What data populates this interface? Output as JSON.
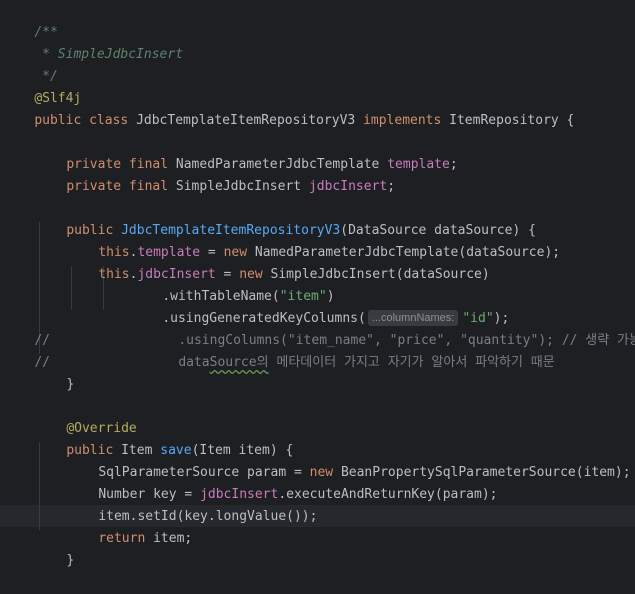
{
  "code": {
    "doc_open": "/**",
    "doc_title": " * SimpleJdbcInsert",
    "doc_close": " */",
    "annotation_slf4j": "@Slf4j",
    "class_decl": {
      "kw1": "public ",
      "kw2": "class ",
      "name": "JdbcTemplateItemRepositoryV3 ",
      "kw3": "implements ",
      "iface": "ItemRepository {"
    },
    "field1": {
      "kw": "private final ",
      "type": "NamedParameterJdbcTemplate ",
      "name": "template",
      "end": ";"
    },
    "field2": {
      "kw": "private final ",
      "type": "SimpleJdbcInsert ",
      "name": "jdbcInsert",
      "end": ";"
    },
    "ctor": {
      "kw": "public ",
      "name": "JdbcTemplateItemRepositoryV3",
      "params": "(DataSource dataSource) {"
    },
    "assign1": {
      "this": "this",
      "dot": ".",
      "field": "template",
      "eq": " = ",
      "new": "new ",
      "rest": "NamedParameterJdbcTemplate(dataSource);"
    },
    "assign2": {
      "this": "this",
      "dot": ".",
      "field": "jdbcInsert",
      "eq": " = ",
      "new": "new ",
      "rest": "SimpleJdbcInsert(dataSource)"
    },
    "with_table": {
      "pre": ".withTableName(",
      "str": "\"item\"",
      "post": ")"
    },
    "using_key": {
      "pre": ".usingGeneratedKeyColumns(",
      "hint": "...columnNames:",
      "str": "\"id\"",
      "post": ");"
    },
    "comment_line1": {
      "slashes": "//",
      "text": ".usingColumns(\"item_name\", \"price\", \"quantity\"); // 생략 가능."
    },
    "comment_line2": {
      "slashes": "//",
      "pre": "data",
      "underlined": "Source의",
      "post": " 메타데이터 가지고 자기가 알아서 파악하기 때문"
    },
    "ctor_close": "}",
    "override": "@Override",
    "save_decl": {
      "kw": "public ",
      "type": "Item ",
      "name": "save",
      "params": "(Item item) {"
    },
    "save_l1": {
      "pre": "SqlParameterSource param = ",
      "new": "new ",
      "rest": "BeanPropertySqlParameterSource(item);"
    },
    "save_l2": {
      "pre": "Number key = ",
      "field": "jdbcInsert",
      "rest": ".executeAndReturnKey(param);"
    },
    "save_l3": "item.setId(key.longValue());",
    "save_l4": {
      "kw": "return ",
      "rest": "item;"
    },
    "save_close": "}"
  }
}
